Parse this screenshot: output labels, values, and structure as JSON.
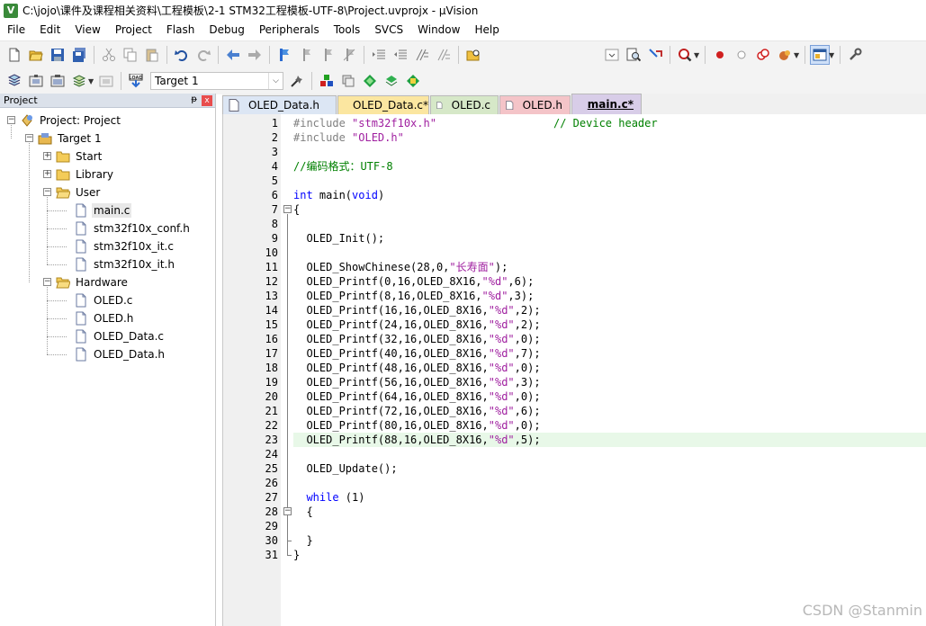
{
  "window": {
    "title": "C:\\jojo\\课件及课程相关资料\\工程模板\\2-1 STM32工程模板-UTF-8\\Project.uvprojx - µVision",
    "icon_label": "V"
  },
  "menu": [
    "File",
    "Edit",
    "View",
    "Project",
    "Flash",
    "Debug",
    "Peripherals",
    "Tools",
    "SVCS",
    "Window",
    "Help"
  ],
  "toolbar2": {
    "target_value": "Target 1",
    "load_label": "LOAD"
  },
  "project_panel": {
    "title": "Project",
    "pin": "ᵽ",
    "close": "x",
    "tree": [
      {
        "label": "Project: Project",
        "level": 0,
        "expander": "minus",
        "icon": "project-icon"
      },
      {
        "label": "Target 1",
        "level": 1,
        "expander": "minus",
        "icon": "target-icon"
      },
      {
        "label": "Start",
        "level": 2,
        "expander": "plus",
        "icon": "folder-icon"
      },
      {
        "label": "Library",
        "level": 2,
        "expander": "plus",
        "icon": "folder-icon"
      },
      {
        "label": "User",
        "level": 2,
        "expander": "minus",
        "icon": "folder-open-icon"
      },
      {
        "label": "main.c",
        "level": 3,
        "icon": "file-icon",
        "selected": true
      },
      {
        "label": "stm32f10x_conf.h",
        "level": 3,
        "icon": "file-icon"
      },
      {
        "label": "stm32f10x_it.c",
        "level": 3,
        "icon": "file-icon"
      },
      {
        "label": "stm32f10x_it.h",
        "level": 3,
        "icon": "file-icon"
      },
      {
        "label": "Hardware",
        "level": 2,
        "expander": "minus",
        "icon": "folder-open-icon"
      },
      {
        "label": "OLED.c",
        "level": 3,
        "icon": "file-icon"
      },
      {
        "label": "OLED.h",
        "level": 3,
        "icon": "file-icon"
      },
      {
        "label": "OLED_Data.c",
        "level": 3,
        "icon": "file-icon"
      },
      {
        "label": "OLED_Data.h",
        "level": 3,
        "icon": "file-icon"
      }
    ]
  },
  "tabs": [
    {
      "label": "OLED_Data.h",
      "color": "#dce6f4",
      "active": false
    },
    {
      "label": "OLED_Data.c*",
      "color": "#fbe6a0",
      "active": false
    },
    {
      "label": "OLED.c",
      "color": "#d6e8c8",
      "active": false
    },
    {
      "label": "OLED.h",
      "color": "#f4c4c8",
      "active": false
    },
    {
      "label": "main.c*",
      "color": "#d8cde8",
      "active": true
    }
  ],
  "editor": {
    "current_line": 23,
    "lines": [
      {
        "n": "1",
        "tokens": [
          [
            "pp",
            "#include "
          ],
          [
            "str",
            "\"stm32f10x.h\""
          ],
          [
            "plain",
            "                  "
          ],
          [
            "cmt",
            "// Device header"
          ]
        ]
      },
      {
        "n": "2",
        "tokens": [
          [
            "pp",
            "#include "
          ],
          [
            "str",
            "\"OLED.h\""
          ]
        ]
      },
      {
        "n": "3",
        "tokens": []
      },
      {
        "n": "4",
        "tokens": [
          [
            "cmt",
            "//编码格式：UTF-8"
          ]
        ]
      },
      {
        "n": "5",
        "tokens": []
      },
      {
        "n": "6",
        "tokens": [
          [
            "kw",
            "int"
          ],
          [
            "plain",
            " main("
          ],
          [
            "kw",
            "void"
          ],
          [
            "plain",
            ")"
          ]
        ]
      },
      {
        "n": "7",
        "tokens": [
          [
            "plain",
            "{"
          ]
        ]
      },
      {
        "n": "8",
        "tokens": []
      },
      {
        "n": "9",
        "tokens": [
          [
            "plain",
            "  OLED_Init();"
          ]
        ]
      },
      {
        "n": "10",
        "tokens": []
      },
      {
        "n": "11",
        "tokens": [
          [
            "plain",
            "  OLED_ShowChinese(28,0,"
          ],
          [
            "str",
            "\"长寿面\""
          ],
          [
            "plain",
            ");"
          ]
        ]
      },
      {
        "n": "12",
        "tokens": [
          [
            "plain",
            "  OLED_Printf(0,16,OLED_8X16,"
          ],
          [
            "str",
            "\"%d\""
          ],
          [
            "plain",
            ",6);"
          ]
        ]
      },
      {
        "n": "13",
        "tokens": [
          [
            "plain",
            "  OLED_Printf(8,16,OLED_8X16,"
          ],
          [
            "str",
            "\"%d\""
          ],
          [
            "plain",
            ",3);"
          ]
        ]
      },
      {
        "n": "14",
        "tokens": [
          [
            "plain",
            "  OLED_Printf(16,16,OLED_8X16,"
          ],
          [
            "str",
            "\"%d\""
          ],
          [
            "plain",
            ",2);"
          ]
        ]
      },
      {
        "n": "15",
        "tokens": [
          [
            "plain",
            "  OLED_Printf(24,16,OLED_8X16,"
          ],
          [
            "str",
            "\"%d\""
          ],
          [
            "plain",
            ",2);"
          ]
        ]
      },
      {
        "n": "16",
        "tokens": [
          [
            "plain",
            "  OLED_Printf(32,16,OLED_8X16,"
          ],
          [
            "str",
            "\"%d\""
          ],
          [
            "plain",
            ",0);"
          ]
        ]
      },
      {
        "n": "17",
        "tokens": [
          [
            "plain",
            "  OLED_Printf(40,16,OLED_8X16,"
          ],
          [
            "str",
            "\"%d\""
          ],
          [
            "plain",
            ",7);"
          ]
        ]
      },
      {
        "n": "18",
        "tokens": [
          [
            "plain",
            "  OLED_Printf(48,16,OLED_8X16,"
          ],
          [
            "str",
            "\"%d\""
          ],
          [
            "plain",
            ",0);"
          ]
        ]
      },
      {
        "n": "19",
        "tokens": [
          [
            "plain",
            "  OLED_Printf(56,16,OLED_8X16,"
          ],
          [
            "str",
            "\"%d\""
          ],
          [
            "plain",
            ",3);"
          ]
        ]
      },
      {
        "n": "20",
        "tokens": [
          [
            "plain",
            "  OLED_Printf(64,16,OLED_8X16,"
          ],
          [
            "str",
            "\"%d\""
          ],
          [
            "plain",
            ",0);"
          ]
        ]
      },
      {
        "n": "21",
        "tokens": [
          [
            "plain",
            "  OLED_Printf(72,16,OLED_8X16,"
          ],
          [
            "str",
            "\"%d\""
          ],
          [
            "plain",
            ",6);"
          ]
        ]
      },
      {
        "n": "22",
        "tokens": [
          [
            "plain",
            "  OLED_Printf(80,16,OLED_8X16,"
          ],
          [
            "str",
            "\"%d\""
          ],
          [
            "plain",
            ",0);"
          ]
        ]
      },
      {
        "n": "23",
        "tokens": [
          [
            "plain",
            "  OLED_Printf(88,16,OLED_8X16,"
          ],
          [
            "str",
            "\"%d\""
          ],
          [
            "plain",
            ",5);"
          ]
        ]
      },
      {
        "n": "24",
        "tokens": []
      },
      {
        "n": "25",
        "tokens": [
          [
            "plain",
            "  OLED_Update();"
          ]
        ]
      },
      {
        "n": "26",
        "tokens": []
      },
      {
        "n": "27",
        "tokens": [
          [
            "plain",
            "  "
          ],
          [
            "kw",
            "while"
          ],
          [
            "plain",
            " (1)"
          ]
        ]
      },
      {
        "n": "28",
        "tokens": [
          [
            "plain",
            "  {"
          ]
        ]
      },
      {
        "n": "29",
        "tokens": []
      },
      {
        "n": "30",
        "tokens": [
          [
            "plain",
            "  }"
          ]
        ]
      },
      {
        "n": "31",
        "tokens": [
          [
            "plain",
            "}"
          ]
        ]
      }
    ]
  },
  "watermark": "CSDN @Stanmin"
}
